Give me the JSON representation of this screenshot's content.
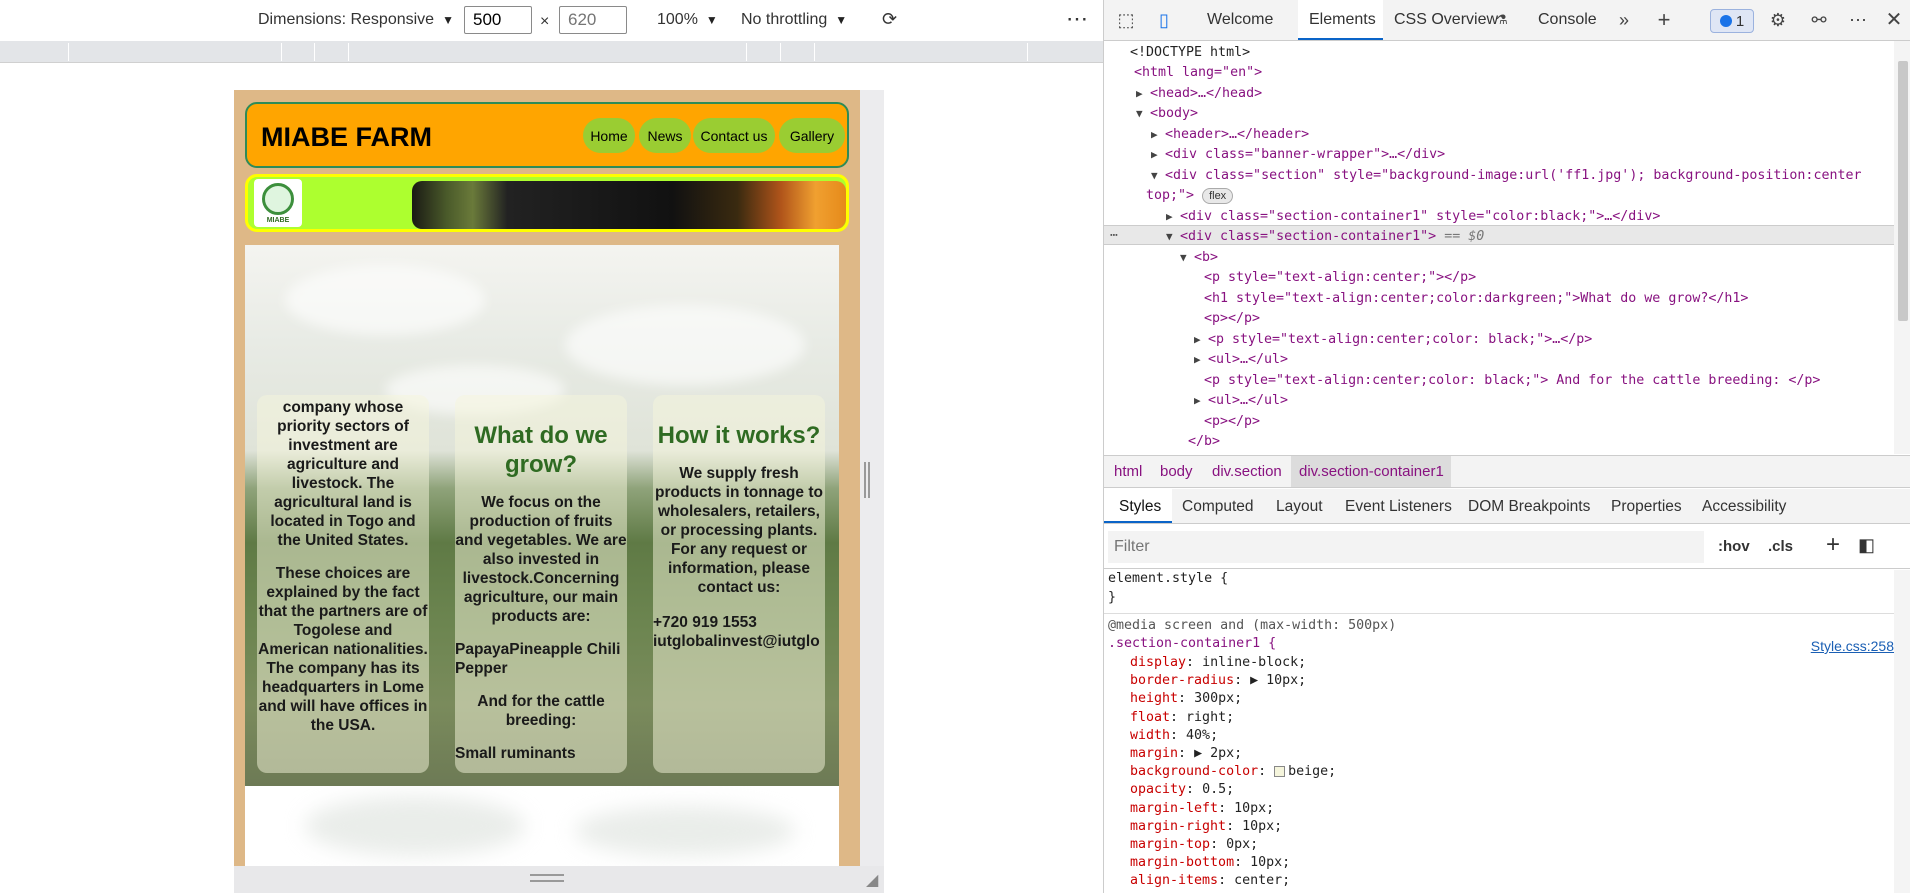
{
  "emulation": {
    "dimensions_label": "Dimensions: Responsive",
    "width_value": "500",
    "height_placeholder": "620",
    "times": "×",
    "zoom": "100%",
    "throttling": "No throttling",
    "more": "⋯"
  },
  "site": {
    "title": "MIABE FARM",
    "nav": [
      "Home",
      "News",
      "Contact us",
      "Gallery"
    ],
    "logo_text": "MIABE",
    "cards": {
      "about": {
        "p1": "company whose priority sectors of investment are agriculture and livestock. The agricultural land is located in Togo and the United States.",
        "p2": "These choices are explained by the fact that the partners are of Togolese and American nationalities. The company has its headquarters in Lome and will have offices in the USA."
      },
      "grow": {
        "heading": "What do we grow?",
        "p1": "We focus on the production of fruits and vegetables. We are also invested in livestock.Concerning agriculture, our main products are:",
        "list": "PapayaPineapple Chili Pepper",
        "p2": "And for the cattle breeding:",
        "list2": "Small ruminants"
      },
      "works": {
        "heading": "How it works?",
        "p1": "We supply fresh products in tonnage to wholesalers, retailers, or processing plants. For any request or information, please contact us:",
        "phone": "+720 919 1553",
        "email": "iutglobalinvest@iutglo"
      }
    }
  },
  "devtools": {
    "tabs": [
      "Welcome",
      "Elements",
      "CSS Overview",
      "Console"
    ],
    "issues_count": "1",
    "dom": {
      "doctype": "<!DOCTYPE html>",
      "html_open": "<html lang=\"en\">",
      "head": "<head>…</head>",
      "body": "<body>",
      "header": "<header>…</header>",
      "banner": "<div class=\"banner-wrapper\">…</div>",
      "section_a": "<div class=\"section\" style=\"background-image:url('ff1.jpg'); background-position:center",
      "section_b": "top;\">",
      "flex": "flex",
      "sc1": "<div class=\"section-container1\" style=\"color:black;\">…</div>",
      "sc1_sel": "<div class=\"section-container1\">",
      "eq": " == $0",
      "b_open": "<b>",
      "p_center": "<p style=\"text-align:center;\"></p>",
      "h1": "<h1 style=\"text-align:center;color:darkgreen;\">What do we grow?</h1>",
      "p_empty": "<p></p>",
      "p_black": "<p style=\"text-align:center;color: black;\">…</p>",
      "ul": "<ul>…</ul>",
      "p_cattle": "<p style=\"text-align:center;color: black;\"> And for the cattle breeding: </p>",
      "ul2": "<ul>…</ul>",
      "p_empty2": "<p></p>",
      "b_close": "</b>",
      "dots": "⋯"
    },
    "breadcrumbs": [
      "html",
      "body",
      "div.section",
      "div.section-container1"
    ],
    "panel_tabs": [
      "Styles",
      "Computed",
      "Layout",
      "Event Listeners",
      "DOM Breakpoints",
      "Properties",
      "Accessibility"
    ],
    "filter_placeholder": "Filter",
    "hov": ":hov",
    "cls": ".cls",
    "styles": {
      "element_style": "element.style {",
      "close": "}",
      "media": "@media screen and (max-width: 500px)",
      "selector": ".section-container1 {",
      "link": "Style.css:258",
      "props": [
        {
          "name": "display",
          "value": "inline-block;"
        },
        {
          "name": "border-radius",
          "value": "▶ 10px;"
        },
        {
          "name": "height",
          "value": "300px;"
        },
        {
          "name": "float",
          "value": "right;"
        },
        {
          "name": "width",
          "value": "40%;"
        },
        {
          "name": "margin",
          "value": "▶ 2px;"
        },
        {
          "name": "background-color",
          "value": "beige;"
        },
        {
          "name": "opacity",
          "value": "0.5;"
        },
        {
          "name": "margin-left",
          "value": "10px;"
        },
        {
          "name": "margin-right",
          "value": "10px;"
        },
        {
          "name": "margin-top",
          "value": "0px;"
        },
        {
          "name": "margin-bottom",
          "value": "10px;"
        },
        {
          "name": "align-items",
          "value": "center;"
        }
      ]
    }
  }
}
